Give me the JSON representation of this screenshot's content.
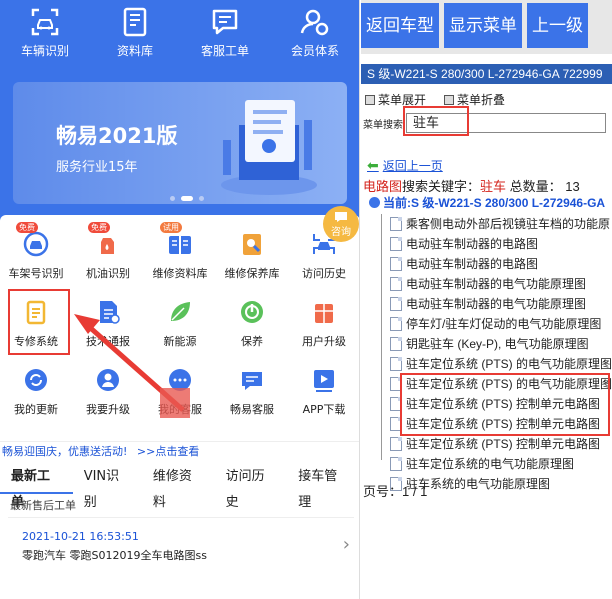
{
  "left": {
    "topnav": [
      {
        "label": "车辆识别",
        "icon": "scan-car-icon"
      },
      {
        "label": "资料库",
        "icon": "book-icon"
      },
      {
        "label": "客服工单",
        "icon": "chat-ticket-icon"
      },
      {
        "label": "会员体系",
        "icon": "member-icon"
      }
    ],
    "banner": {
      "title": "畅易2021版",
      "subtitle": "服务行业15年"
    },
    "consult_label": "咨询",
    "grid": [
      [
        {
          "label": "车架号识别",
          "icon": "vin-scan-icon",
          "badge": "免费",
          "color": "#3b73e8"
        },
        {
          "label": "机油识别",
          "icon": "oil-icon",
          "badge": "免费",
          "color": "#f06a4a"
        },
        {
          "label": "维修资料库",
          "icon": "repair-docs-icon",
          "badge": "试用",
          "color": "#3b73e8"
        },
        {
          "label": "维修保养库",
          "icon": "maintenance-icon",
          "badge": "",
          "color": "#f0a23a"
        },
        {
          "label": "访问历史",
          "icon": "history-car-icon",
          "badge": "",
          "color": "#3b73e8"
        }
      ],
      [
        {
          "label": "专修系统",
          "icon": "clipboard-icon",
          "badge": "",
          "color": "#f2b733"
        },
        {
          "label": "技术通报",
          "icon": "bulletin-icon",
          "badge": "",
          "color": "#3b73e8"
        },
        {
          "label": "新能源",
          "icon": "leaf-icon",
          "badge": "",
          "color": "#5ac15a"
        },
        {
          "label": "保养",
          "icon": "power-gauge-icon",
          "badge": "",
          "color": "#5ac15a"
        },
        {
          "label": "用户升级",
          "icon": "gift-icon",
          "badge": "",
          "color": "#f06a4a"
        }
      ],
      [
        {
          "label": "我的更新",
          "icon": "refresh-icon",
          "badge": "",
          "color": "#3b73e8"
        },
        {
          "label": "我要升级",
          "icon": "user-upgrade-icon",
          "badge": "",
          "color": "#3b73e8"
        },
        {
          "label": "我的客服",
          "icon": "support-chat-icon",
          "badge": "",
          "color": "#3b73e8"
        },
        {
          "label": "畅易客服",
          "icon": "message-icon",
          "badge": "",
          "color": "#3b73e8"
        },
        {
          "label": "APP下载",
          "icon": "play-download-icon",
          "badge": "",
          "color": "#3b73e8"
        }
      ]
    ],
    "promo_text": "畅易迎国庆，优惠送活动!",
    "promo_link": ">>点击查看",
    "tabs": [
      "最新工单",
      "VIN识别",
      "维修资料",
      "访问历史",
      "接车管理"
    ],
    "section_title": "最新售后工单",
    "card": {
      "date": "2021-10-21 16:53:51",
      "desc": "零跑汽车 零跑S012019全车电路图ss"
    }
  },
  "right": {
    "buttons": [
      "返回车型",
      "显示菜单",
      "上一级"
    ],
    "model": "S 级-W221-S 280/300 L-272946-GA 722999",
    "menu_expand": "菜单展开",
    "menu_collapse": "菜单折叠",
    "search_label": "菜单搜索",
    "search_value": "驻车",
    "back_link": "返回上一页",
    "result_prefix": "电路图",
    "result_mid": "搜索关键字：",
    "result_keyword": "驻车",
    "result_count_label": " 总数量：",
    "result_count": "13",
    "current_label": "当前:S 级-W221-S 280/300 L-272946-GA",
    "items": [
      "乘客侧电动外部后视镜驻车档的功能原",
      "电动驻车制动器的电路图",
      "电动驻车制动器的电路图",
      "电动驻车制动器的电气功能原理图",
      "电动驻车制动器的电气功能原理图",
      "停车灯/驻车灯促动的电气功能原理图",
      "钥匙驻车 (Key-P), 电气功能原理图",
      "驻车定位系统 (PTS) 的电气功能原理图",
      "驻车定位系统 (PTS) 的电气功能原理图",
      "驻车定位系统 (PTS) 控制单元电路图",
      "驻车定位系统 (PTS) 控制单元电路图",
      "驻车定位系统 (PTS) 控制单元电路图",
      "驻车定位系统的电气功能原理图",
      "驻车系统的电气功能原理图"
    ],
    "pager": "页号：1 / 1"
  }
}
